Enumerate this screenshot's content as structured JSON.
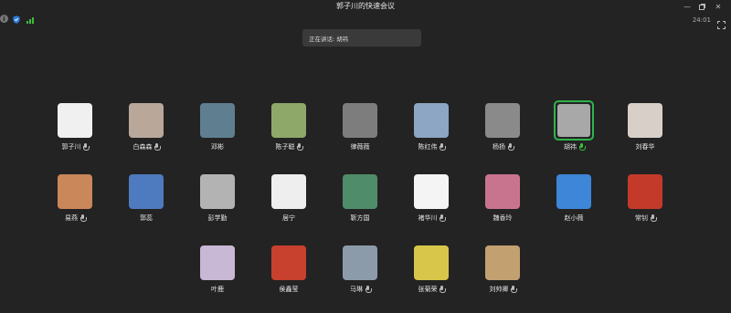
{
  "window": {
    "title": "郭子川的快速会议"
  },
  "status": {
    "timer": "24:01"
  },
  "speaking": {
    "text": "正在讲话: 胡祎"
  },
  "participants": [
    {
      "name": "郭子川",
      "mic": true,
      "active": false,
      "color": "#f0f0f0"
    },
    {
      "name": "白森森",
      "mic": true,
      "active": false,
      "color": "#b9a89a"
    },
    {
      "name": "邓彬",
      "mic": false,
      "active": false,
      "color": "#5f7f91"
    },
    {
      "name": "陈子聪",
      "mic": true,
      "active": false,
      "color": "#8ea86a"
    },
    {
      "name": "律薇薇",
      "mic": false,
      "active": false,
      "color": "#7d7d7d"
    },
    {
      "name": "陈红伟",
      "mic": true,
      "active": false,
      "color": "#8ca6c3"
    },
    {
      "name": "杨扬",
      "mic": true,
      "active": false,
      "color": "#8a8a8a"
    },
    {
      "name": "胡祎",
      "mic": true,
      "active": true,
      "color": "#a8a8a8"
    },
    {
      "name": "刘春华",
      "mic": false,
      "active": false,
      "color": "#d8d0c8"
    },
    {
      "name": "易燕",
      "mic": true,
      "active": false,
      "color": "#c9875a"
    },
    {
      "name": "郭蕊",
      "mic": false,
      "active": false,
      "color": "#4e7bbf"
    },
    {
      "name": "彭学勤",
      "mic": false,
      "active": false,
      "color": "#b3b3b3"
    },
    {
      "name": "居宁",
      "mic": false,
      "active": false,
      "color": "#eeeeee"
    },
    {
      "name": "靳方国",
      "mic": false,
      "active": false,
      "color": "#4f8c6a"
    },
    {
      "name": "褚华川",
      "mic": true,
      "active": false,
      "color": "#f4f4f4"
    },
    {
      "name": "魏香玲",
      "mic": false,
      "active": false,
      "color": "#c9748e"
    },
    {
      "name": "赵小薇",
      "mic": false,
      "active": false,
      "color": "#3d86d8"
    },
    {
      "name": "常钊",
      "mic": true,
      "active": false,
      "color": "#c33a2a"
    },
    {
      "name": "叶鹿",
      "mic": false,
      "active": false,
      "color": "#c9b7d6"
    },
    {
      "name": "侯鑫莹",
      "mic": false,
      "active": false,
      "color": "#c8402e"
    },
    {
      "name": "马琳",
      "mic": true,
      "active": false,
      "color": "#8c9baa"
    },
    {
      "name": "张菊荣",
      "mic": true,
      "active": false,
      "color": "#d8c64a"
    },
    {
      "name": "刘帅卿",
      "mic": true,
      "active": false,
      "color": "#c3a070"
    }
  ]
}
